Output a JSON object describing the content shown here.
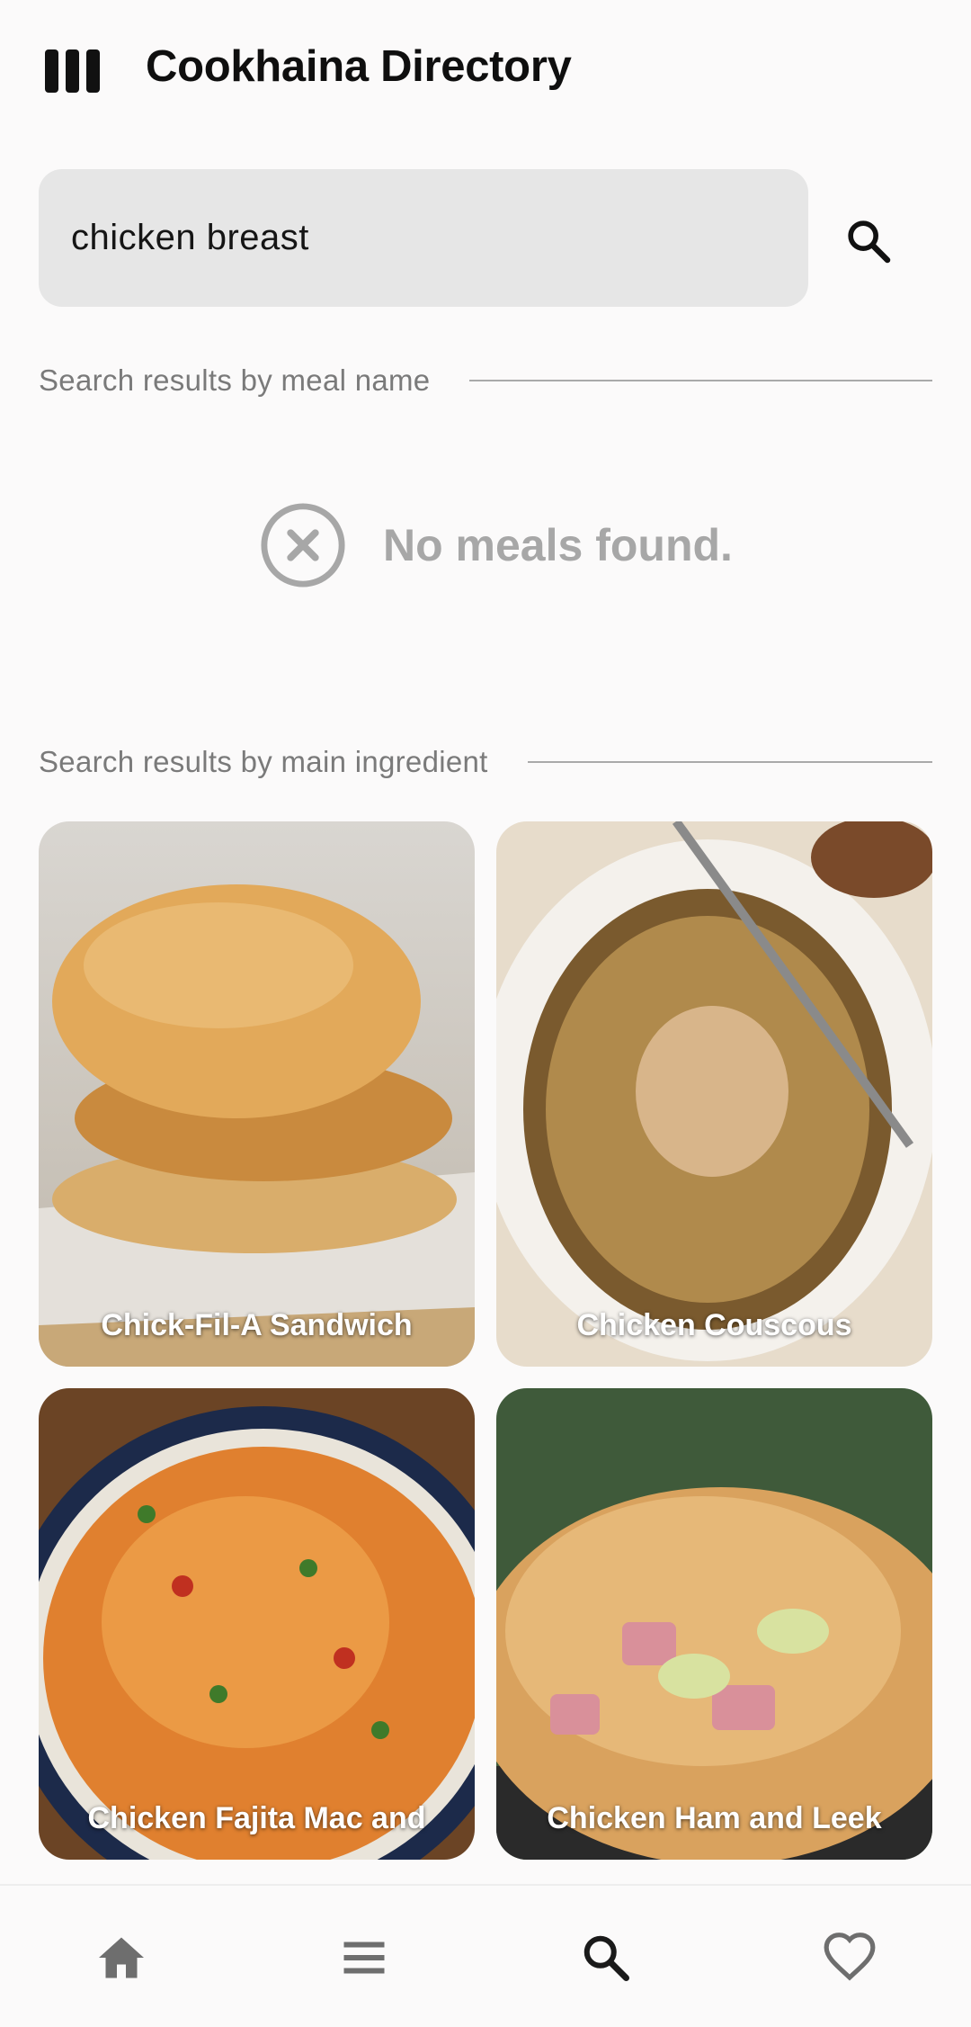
{
  "app": {
    "title": "Cookhaina Directory",
    "accent_color": "#111111",
    "icons": {
      "logo": "restaurant-menu-icon",
      "search": "search-icon"
    }
  },
  "search": {
    "value": "chicken breast",
    "placeholder": "",
    "button_icon": "search-icon"
  },
  "sections": {
    "by_name": {
      "label": "Search results by meal name",
      "empty_icon": "cancel-circle-icon",
      "empty_message": "No meals found."
    },
    "by_ingredient": {
      "label": "Search results by main ingredient",
      "meals": [
        {
          "name": "Chick-Fil-A Sandwich"
        },
        {
          "name": "Chicken Couscous"
        },
        {
          "name": "Chicken Fajita Mac and"
        },
        {
          "name": "Chicken Ham and Leek"
        }
      ]
    }
  },
  "bottom_nav": {
    "items": [
      {
        "icon": "home-icon",
        "selected": false
      },
      {
        "icon": "menu-icon",
        "selected": false
      },
      {
        "icon": "search-icon",
        "selected": true
      },
      {
        "icon": "heart-icon",
        "selected": false
      }
    ],
    "selected_color": "#1a1a1a",
    "unselected_color": "#6e6e6e"
  }
}
